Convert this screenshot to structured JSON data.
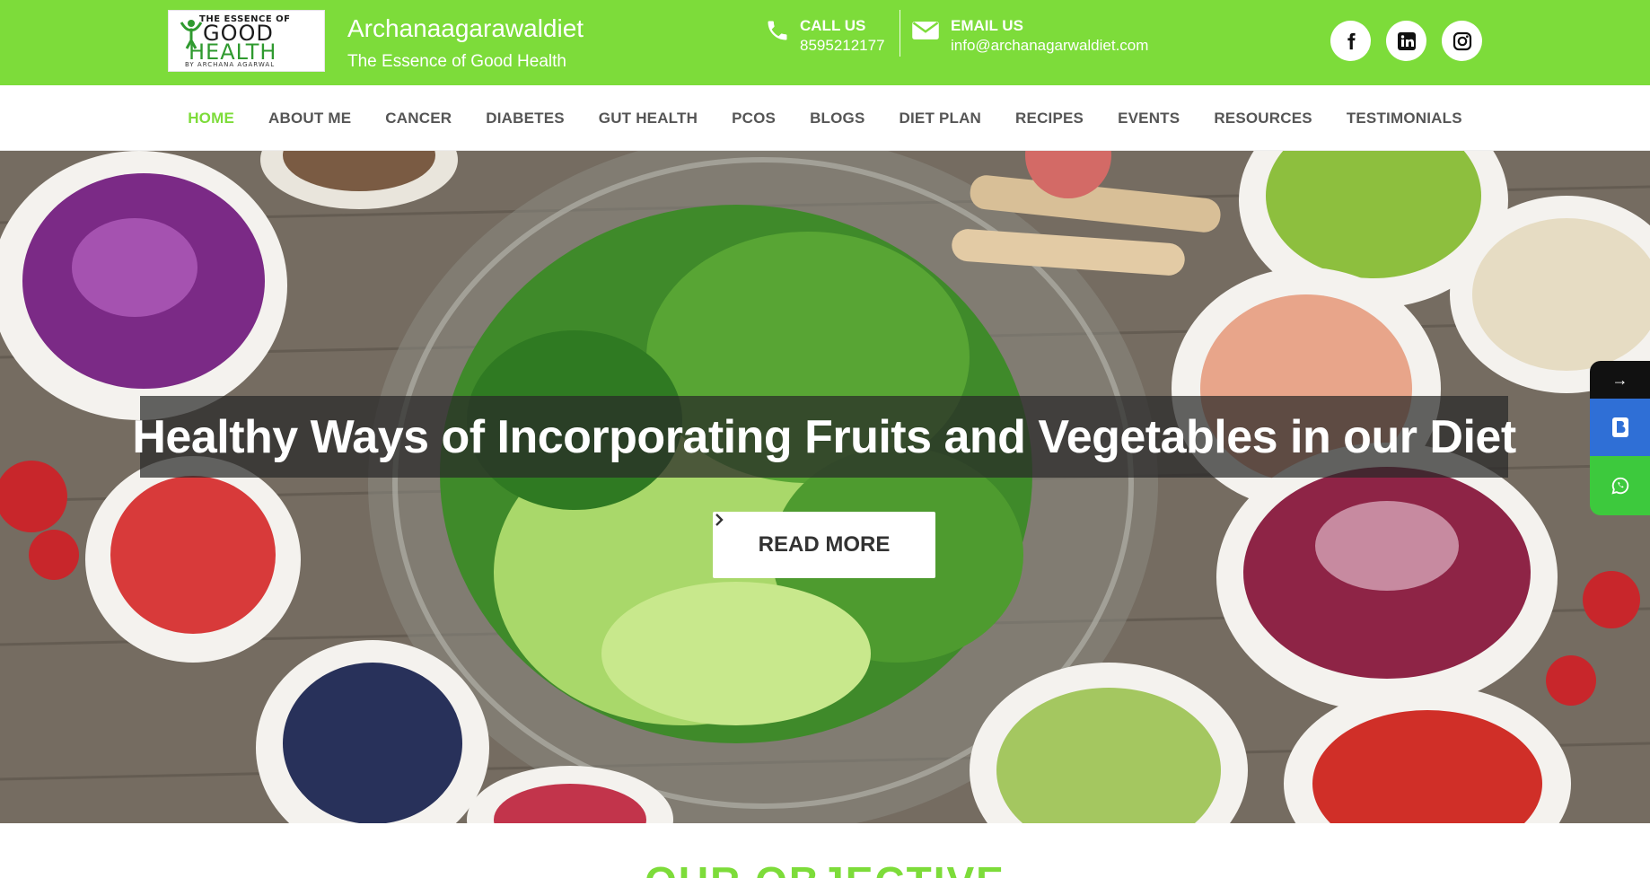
{
  "header": {
    "logo": {
      "top_text": "THE ESSENCE OF",
      "word1": "GOOD",
      "word2": "HEALTH",
      "by_text": "BY ARCHANA AGARWAL"
    },
    "site_title": "Archanaagarawaldiet",
    "tagline": "The Essence of Good Health",
    "call": {
      "label": "CALL US",
      "value": "8595212177",
      "icon": "phone-icon"
    },
    "email": {
      "label": "EMAIL US",
      "value": "info@archanagarwaldiet.com",
      "icon": "envelope-icon"
    },
    "social": [
      "facebook-icon",
      "linkedin-icon",
      "instagram-icon"
    ],
    "bar_color": "#7ddc3a"
  },
  "nav": {
    "items": [
      {
        "label": "HOME",
        "active": true
      },
      {
        "label": "ABOUT ME"
      },
      {
        "label": "CANCER"
      },
      {
        "label": "DIABETES"
      },
      {
        "label": "GUT HEALTH"
      },
      {
        "label": "PCOS"
      },
      {
        "label": "BLOGS"
      },
      {
        "label": "DIET PLAN"
      },
      {
        "label": "RECIPES"
      },
      {
        "label": "EVENTS"
      },
      {
        "label": "RESOURCES"
      },
      {
        "label": "TESTIMONIALS"
      }
    ],
    "active_color": "#7ddc3a"
  },
  "hero": {
    "title": "Healthy Ways of Incorporating Fruits and Vegetables in our Diet",
    "button_label": "READ MORE",
    "button_icon": "chevron-right-icon"
  },
  "side_widgets": {
    "arrow": "→",
    "booking_icon": "booking-icon",
    "whatsapp_icon": "whatsapp-icon"
  },
  "section": {
    "heading": "OUR OBJECTIVE"
  }
}
